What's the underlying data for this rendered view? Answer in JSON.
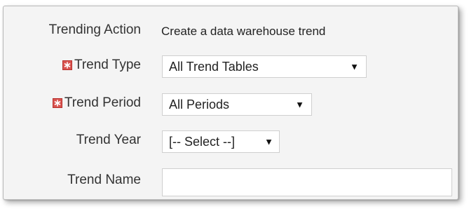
{
  "form": {
    "trending_action": {
      "label": "Trending Action",
      "value": "Create a data warehouse trend"
    },
    "trend_type": {
      "label": "Trend Type",
      "required": true,
      "selected": "All Trend Tables",
      "icon": "required-icon"
    },
    "trend_period": {
      "label": "Trend Period",
      "required": true,
      "selected": "All Periods",
      "icon": "required-icon"
    },
    "trend_year": {
      "label": "Trend Year",
      "selected": "[-- Select --]"
    },
    "trend_name": {
      "label": "Trend Name",
      "value": "",
      "placeholder": ""
    }
  },
  "colors": {
    "panel_bg": "#f4f4f4",
    "required_icon": "#d9534f",
    "label_text": "#333333"
  }
}
